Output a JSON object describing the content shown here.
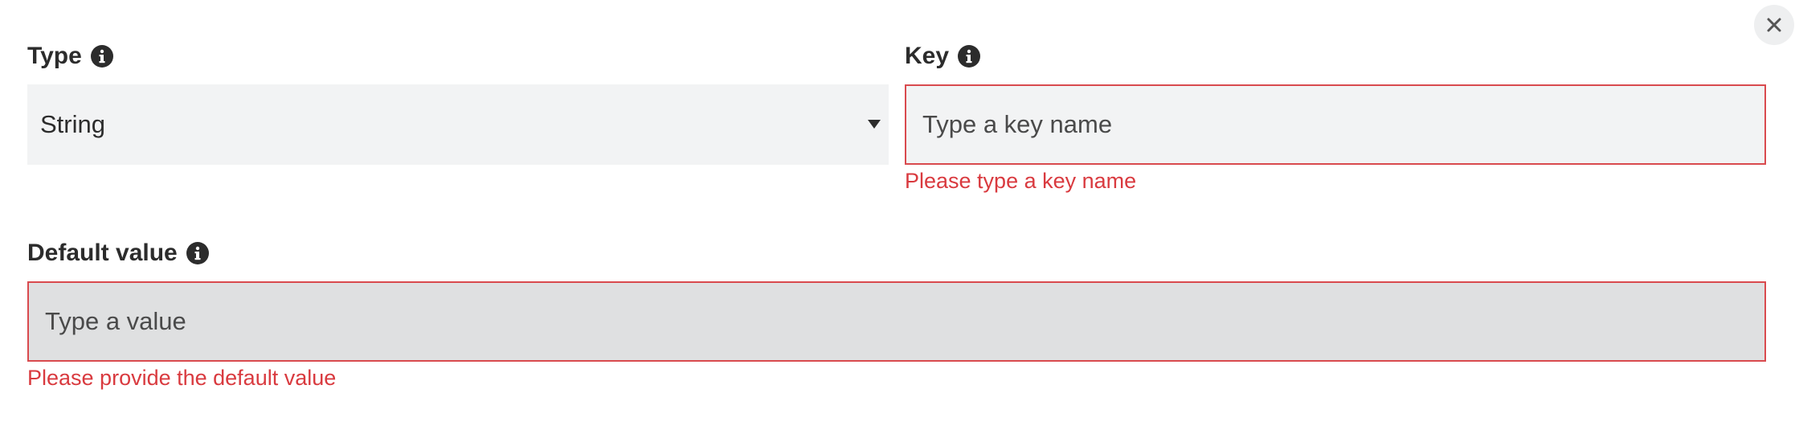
{
  "type_field": {
    "label": "Type",
    "info_icon": "info-icon",
    "selected_value": "String",
    "caret_icon": "caret-down-icon"
  },
  "key_field": {
    "label": "Key",
    "info_icon": "info-icon",
    "placeholder": "Type a key name",
    "error": "Please type a key name"
  },
  "default_value_field": {
    "label": "Default value",
    "info_icon": "info-icon",
    "placeholder": "Type a value",
    "error": "Please provide the default value"
  },
  "close_button": {
    "icon": "close-icon"
  },
  "colors": {
    "error": "#d93a3f",
    "field_background": "#f2f3f4",
    "focused_field_background": "#dfe0e1",
    "label": "#2c2c2c"
  }
}
